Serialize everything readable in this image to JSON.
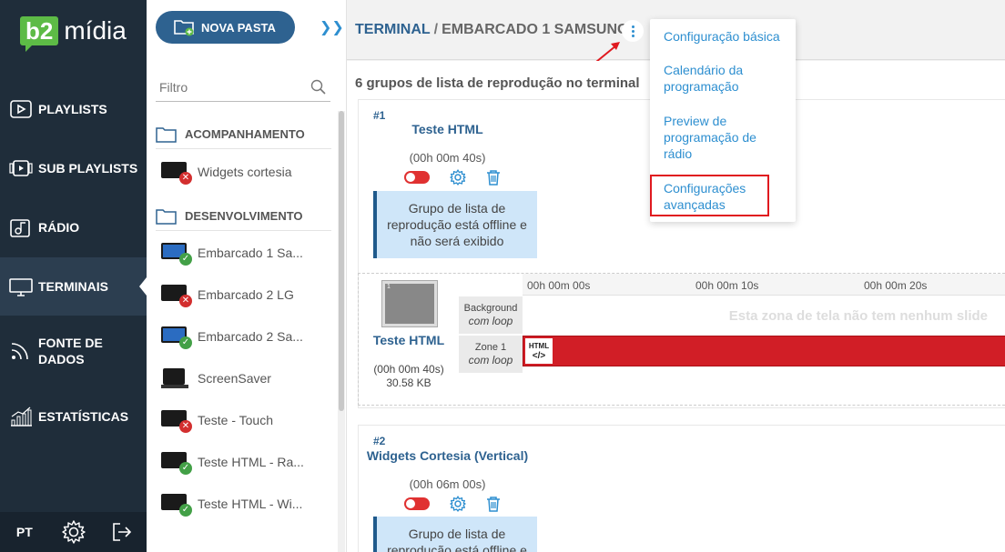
{
  "nav": {
    "logo_badge": "b2",
    "logo_text": "mídia",
    "items": [
      {
        "label": "PLAYLISTS",
        "icon": "play-icon"
      },
      {
        "label": "SUB PLAYLISTS",
        "icon": "sub-playlist-icon"
      },
      {
        "label": "RÁDIO",
        "icon": "radio-icon"
      },
      {
        "label": "TERMINAIS",
        "icon": "monitor-icon"
      },
      {
        "label": "FONTE DE DADOS",
        "icon": "rss-icon"
      },
      {
        "label": "ESTATÍSTICAS",
        "icon": "chart-icon"
      }
    ],
    "active": "TERMINAIS",
    "language": "PT"
  },
  "folders": {
    "new_folder_label": "NOVA PASTA",
    "filter_placeholder": "Filtro",
    "groups": [
      {
        "name": "ACOMPANHAMENTO",
        "items": [
          {
            "label": "Widgets cortesia",
            "status": "offline"
          }
        ]
      },
      {
        "name": "DESENVOLVIMENTO",
        "items": [
          {
            "label": "Embarcado 1 Sa...",
            "status": "online"
          },
          {
            "label": "Embarcado 2 LG",
            "status": "offline"
          },
          {
            "label": "Embarcado 2 Sa...",
            "status": "online"
          },
          {
            "label": "ScreenSaver",
            "status": "none"
          },
          {
            "label": "Teste - Touch",
            "status": "offline"
          },
          {
            "label": "Teste HTML - Ra...",
            "status": "online"
          },
          {
            "label": "Teste HTML - Wi...",
            "status": "online"
          }
        ]
      }
    ]
  },
  "header": {
    "breadcrumb_root": "TERMINAL",
    "breadcrumb_sep": "/",
    "breadcrumb_current": "EMBARCADO 1 SAMSUNG"
  },
  "main": {
    "groups_title": "6 grupos de lista de reprodução no terminal",
    "groups": [
      {
        "number": "#1",
        "name": "Teste HTML",
        "duration": "(00h 00m 40s)",
        "offline_msg": "Grupo de lista de reprodução está offline e não será exibido"
      },
      {
        "number": "#2",
        "name": "Widgets Cortesia (Vertical)",
        "duration": "(00h 06m 00s)",
        "offline_msg": "Grupo de lista de reprodução está offline e não será exibido"
      }
    ],
    "timeline": {
      "item_name": "Teste HTML",
      "item_duration": "(00h 00m 40s)",
      "item_size": "30.58 KB",
      "thumb_label": "1",
      "ticks": [
        "00h 00m 00s",
        "00h 00m 10s",
        "00h 00m 20s"
      ],
      "zones": [
        {
          "name": "Background",
          "mode": "com loop",
          "empty_msg": "Esta zona de tela não tem nenhum slide"
        },
        {
          "name": "Zone 1",
          "mode": "com loop",
          "chip_label": "HTML",
          "chip_code": "</>"
        }
      ]
    }
  },
  "menu": {
    "items": [
      "Configuração básica",
      "Calendário da programação",
      "Preview de programação de rádio",
      "Configurações avançadas"
    ],
    "highlighted": "Configurações avançadas"
  },
  "colors": {
    "accent": "#2e6290",
    "link": "#2e8fd0",
    "nav_bg": "#1f2d3a",
    "error": "#d11e26",
    "success": "#43a047"
  }
}
